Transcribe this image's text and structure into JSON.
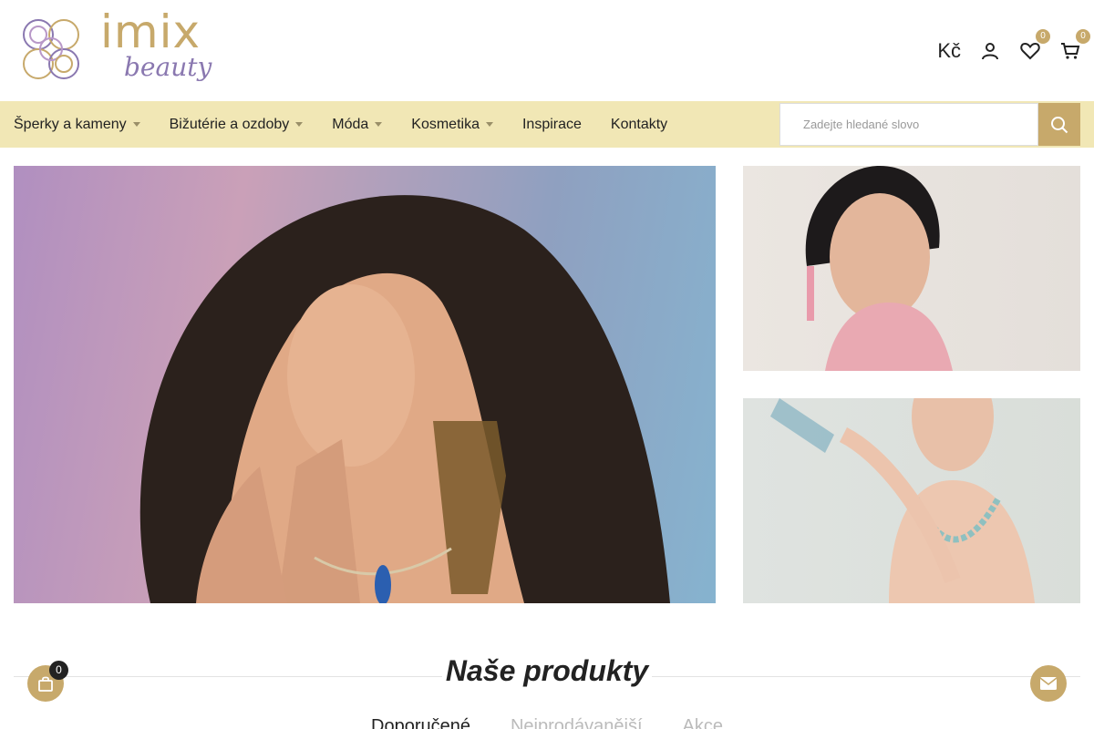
{
  "logo": {
    "word": "imix",
    "sub": "beauty"
  },
  "header": {
    "currency": "Kč",
    "wishlist_count": "0",
    "cart_count": "0"
  },
  "nav": {
    "items": [
      {
        "label": "Šperky a kameny",
        "has_dropdown": true
      },
      {
        "label": "Bižutérie a ozdoby",
        "has_dropdown": true
      },
      {
        "label": "Móda",
        "has_dropdown": true
      },
      {
        "label": "Kosmetika",
        "has_dropdown": true
      },
      {
        "label": "Inspirace",
        "has_dropdown": false
      },
      {
        "label": "Kontakty",
        "has_dropdown": false
      }
    ]
  },
  "search": {
    "placeholder": "Zadejte hledané slovo"
  },
  "products": {
    "title": "Naše produkty",
    "tabs": [
      "Doporučené",
      "Nejprodávanější",
      "Akce"
    ]
  },
  "floating": {
    "cart_count": "0"
  },
  "colors": {
    "accent": "#c7a96b",
    "nav_bg": "#f1e7b5",
    "logo_purple": "#8a78b0"
  }
}
